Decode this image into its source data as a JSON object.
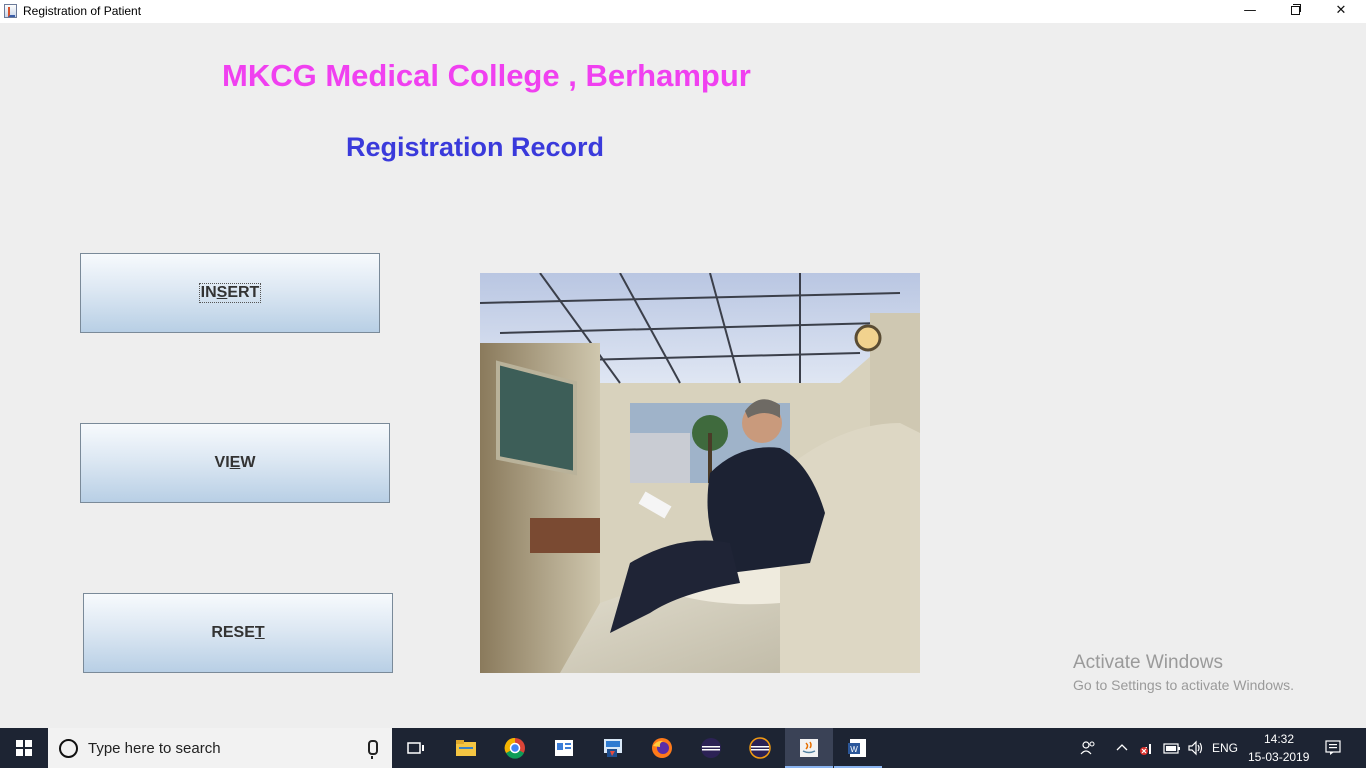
{
  "window": {
    "title": "Registration of Patient",
    "minimize_glyph": "—",
    "close_glyph": "✕"
  },
  "headings": {
    "college": "MKCG Medical College , Berhampur",
    "record": "Registration Record"
  },
  "buttons": {
    "insert": {
      "pre": "IN",
      "mnemonic": "S",
      "post": "ERT"
    },
    "view": {
      "pre": "VI",
      "mnemonic": "E",
      "post": "W"
    },
    "reset": {
      "pre": "RESE",
      "mnemonic": "T",
      "post": ""
    }
  },
  "watermark": {
    "title": "Activate Windows",
    "subtitle": "Go to Settings to activate Windows."
  },
  "taskbar": {
    "search_placeholder": "Type here to search",
    "language": "ENG",
    "time": "14:32",
    "date": "15-03-2019",
    "pinned": [
      "task-view",
      "file-explorer",
      "chrome",
      "app-window",
      "remote-tool",
      "firefox",
      "eclipse",
      "eclipse",
      "java",
      "word"
    ]
  },
  "colors": {
    "college_heading": "#f040f0",
    "record_heading": "#3a3adb",
    "window_bg": "#eeeeee",
    "taskbar_bg": "#1d2433"
  }
}
